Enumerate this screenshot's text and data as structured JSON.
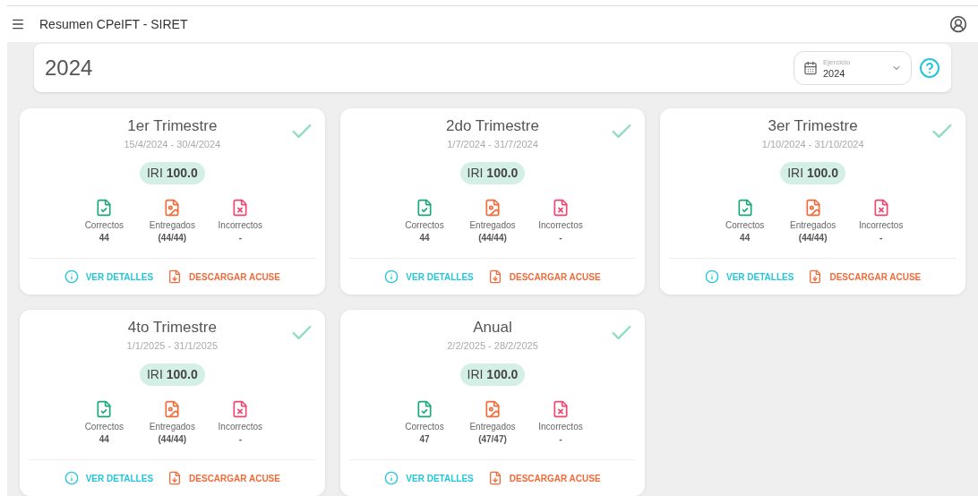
{
  "app_bar": {
    "title": "Resumen CPeIFT - SIRET"
  },
  "header": {
    "year": "2024",
    "select": {
      "label": "Ejercicio",
      "value": "2024"
    }
  },
  "periods": [
    {
      "title": "1er Trimestre",
      "dates": "15/4/2024 - 30/4/2024",
      "complete": true,
      "score": "IRI **100.0**",
      "stats": [
        {
          "kind": "correct",
          "label": "Correctos",
          "value": "44"
        },
        {
          "kind": "delivered",
          "label": "Entregados",
          "value": "(44/44)"
        },
        {
          "kind": "incorrect",
          "label": "Incorrectos",
          "value": "-"
        }
      ],
      "actions": [
        "VER DETALLES",
        "DESCARGAR ACUSE"
      ]
    },
    {
      "title": "2do Trimestre",
      "dates": "1/7/2024 - 31/7/2024",
      "complete": true,
      "score": "IRI **100.0**",
      "stats": [
        {
          "kind": "correct",
          "label": "Correctos",
          "value": "44"
        },
        {
          "kind": "delivered",
          "label": "Entregados",
          "value": "(44/44)"
        },
        {
          "kind": "incorrect",
          "label": "Incorrectos",
          "value": "-"
        }
      ],
      "actions": [
        "VER DETALLES",
        "DESCARGAR ACUSE"
      ]
    },
    {
      "title": "3er Trimestre",
      "dates": "1/10/2024 - 31/10/2024",
      "complete": true,
      "score": "IRI **100.0**",
      "stats": [
        {
          "kind": "correct",
          "label": "Correctos",
          "value": "44"
        },
        {
          "kind": "delivered",
          "label": "Entregados",
          "value": "(44/44)"
        },
        {
          "kind": "incorrect",
          "label": "Incorrectos",
          "value": "-"
        }
      ],
      "actions": [
        "VER DETALLES",
        "DESCARGAR ACUSE"
      ]
    },
    {
      "title": "4to Trimestre",
      "dates": "1/1/2025 - 31/1/2025",
      "complete": true,
      "score": "IRI **100.0**",
      "stats": [
        {
          "kind": "correct",
          "label": "Correctos",
          "value": "44"
        },
        {
          "kind": "delivered",
          "label": "Entregados",
          "value": "(44/44)"
        },
        {
          "kind": "incorrect",
          "label": "Incorrectos",
          "value": "-"
        }
      ],
      "actions": [
        "VER DETALLES",
        "DESCARGAR ACUSE"
      ]
    },
    {
      "title": "Anual",
      "dates": "2/2/2025 - 28/2/2025",
      "complete": true,
      "score": "IRI **100.0**",
      "stats": [
        {
          "kind": "correct",
          "label": "Correctos",
          "value": "47"
        },
        {
          "kind": "delivered",
          "label": "Entregados",
          "value": "(47/47)"
        },
        {
          "kind": "incorrect",
          "label": "Incorrectos",
          "value": "-"
        }
      ],
      "actions": [
        "VER DETALLES",
        "DESCARGAR ACUSE"
      ]
    }
  ]
}
